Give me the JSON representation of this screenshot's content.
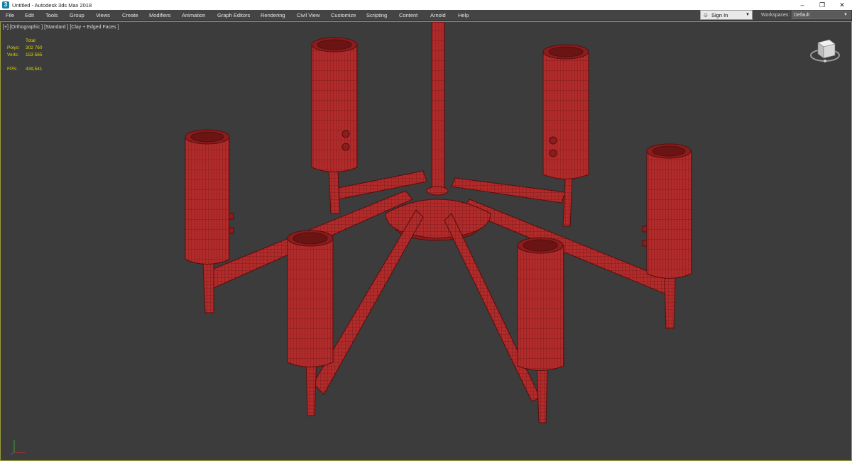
{
  "titlebar": {
    "title": "Untitled - Autodesk 3ds Max 2018",
    "minimize": "–",
    "restore": "❐",
    "close": "✕"
  },
  "menu": [
    "File",
    "Edit",
    "Tools",
    "Group",
    "Views",
    "Create",
    "Modifiers",
    "Animation",
    "Graph Editors",
    "Rendering",
    "Civil View",
    "Customize",
    "Scripting",
    "Content",
    "Arnold",
    "Help"
  ],
  "signin": {
    "label": "Sign In",
    "icon": "user-icon"
  },
  "workspaces": {
    "label": "Workspaces:",
    "value": "Default"
  },
  "viewport": {
    "label": "[+] [Orthographic ] [Standard ] [Clay + Edged Faces ]",
    "stats": {
      "total_label": "Total",
      "polys_label": "Polys:",
      "polys_value": "302 760",
      "verts_label": "Verts:",
      "verts_value": "153 565",
      "fps_label": "FPS:",
      "fps_value": "439,541"
    }
  },
  "colors": {
    "model": "#b12b2b",
    "model_edge": "#5a0c0c",
    "background": "#3c3c3c",
    "stats": "#e0d400"
  }
}
